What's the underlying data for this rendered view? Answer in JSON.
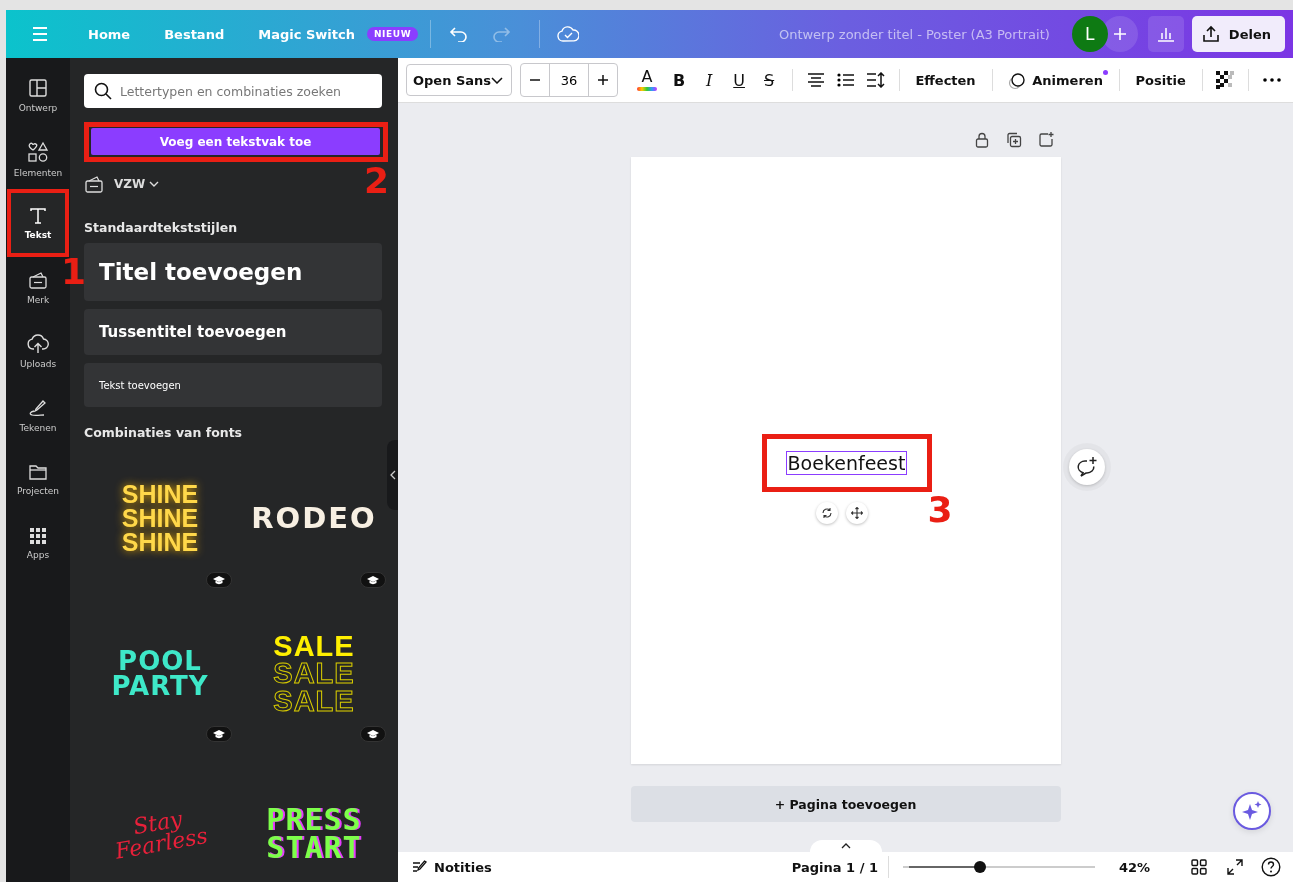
{
  "topbar": {
    "menu_items": [
      {
        "label": "Home"
      },
      {
        "label": "Bestand"
      },
      {
        "label": "Magic Switch",
        "badge": "NIEUW"
      }
    ],
    "redo_disabled": true,
    "document_title": "Ontwerp zonder titel - Poster (A3 Portrait)",
    "avatar_initial": "L",
    "share_label": "Delen"
  },
  "rail": [
    {
      "label": "Ontwerp",
      "selected": false,
      "highlighted": false
    },
    {
      "label": "Elementen",
      "selected": false,
      "highlighted": false
    },
    {
      "label": "Tekst",
      "selected": true,
      "highlighted": true,
      "annotation": "1"
    },
    {
      "label": "Merk",
      "selected": false,
      "highlighted": false
    },
    {
      "label": "Uploads",
      "selected": false,
      "highlighted": false
    },
    {
      "label": "Tekenen",
      "selected": false,
      "highlighted": false
    },
    {
      "label": "Projecten",
      "selected": false,
      "highlighted": false
    },
    {
      "label": "Apps",
      "selected": false,
      "highlighted": false
    }
  ],
  "panel": {
    "search_placeholder": "Lettertypen en combinaties zoeken",
    "add_textbox": {
      "label": "Voeg een tekstvak toe",
      "highlighted": true,
      "annotation": "2"
    },
    "brand_kit": "VZW",
    "styles_heading": "Standaardtekststijlen",
    "styles": [
      {
        "kind": "title",
        "label": "Titel toevoegen"
      },
      {
        "kind": "subtitle",
        "label": "Tussentitel toevoegen"
      },
      {
        "kind": "body",
        "label": "Tekst toevoegen"
      }
    ],
    "combos_heading": "Combinaties van fonts",
    "combos": [
      {
        "kind": "neon",
        "lines": [
          "SHINE",
          "SHINE",
          "SHINE"
        ],
        "badge": true
      },
      {
        "kind": "rodeo",
        "lines": [
          "RODEO"
        ],
        "badge": true
      },
      {
        "kind": "pool",
        "lines": [
          "POOL",
          "PARTY"
        ],
        "badge": true
      },
      {
        "kind": "sale",
        "lines": [
          "SALE",
          "SALE",
          "SALE"
        ],
        "badge": true
      },
      {
        "kind": "script",
        "lines": [
          "Stay",
          "Fearless"
        ],
        "badge": false
      },
      {
        "kind": "press",
        "lines": [
          "PRESS",
          "START"
        ],
        "badge": false
      }
    ]
  },
  "toolbar": {
    "font": "Open Sans",
    "font_size": "36",
    "color_letter": "A",
    "format_buttons": [
      {
        "kind": "bold",
        "label": "B"
      },
      {
        "kind": "italic",
        "label": "I"
      },
      {
        "kind": "underline",
        "label": "U"
      },
      {
        "kind": "strike",
        "label": "S"
      }
    ],
    "effects": "Effecten",
    "animate": "Animeren",
    "position": "Positie"
  },
  "canvas": {
    "text_element": {
      "text": "Boekenfeest",
      "selected": true,
      "highlighted": true,
      "annotation": "3"
    },
    "add_page": "+ Pagina toevoegen"
  },
  "bottom_bar": {
    "notes": "Notities",
    "page_indicator": "Pagina 1 / 1",
    "zoom": {
      "level": 0.37,
      "reading": "42%"
    }
  }
}
